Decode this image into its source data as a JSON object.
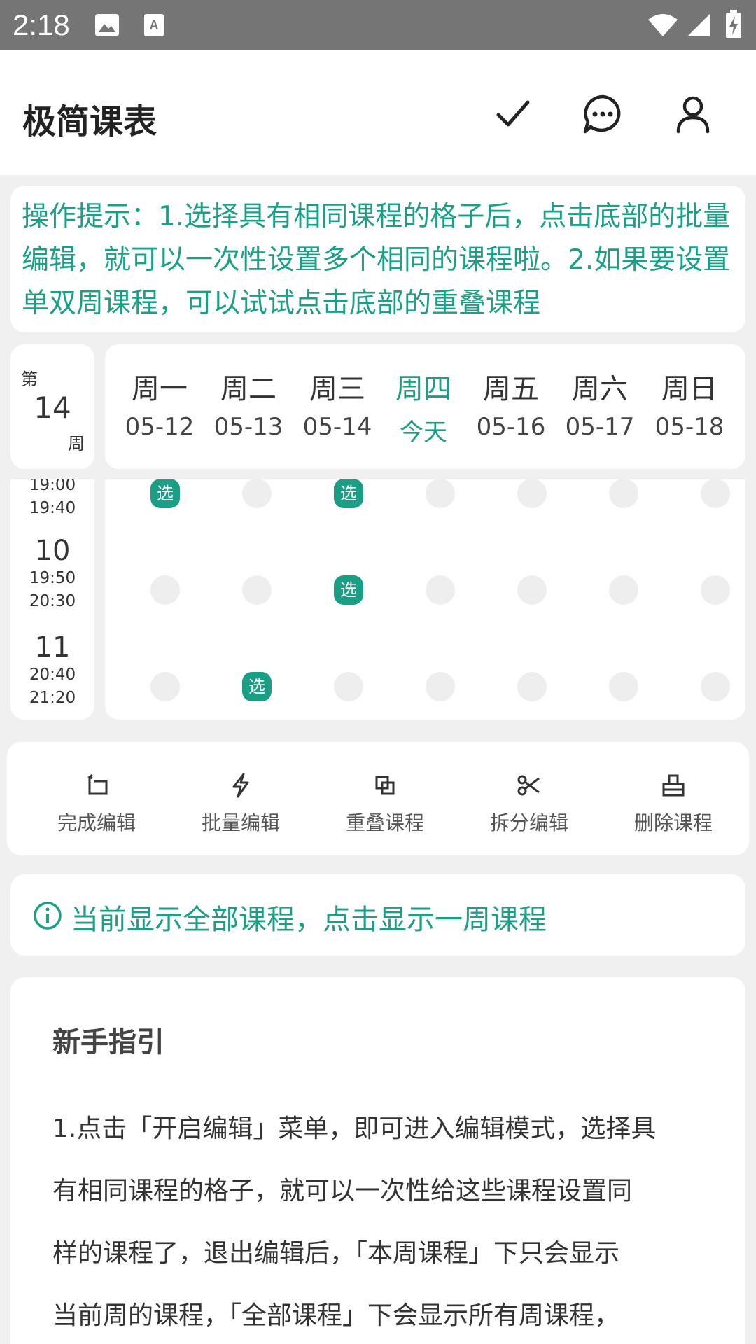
{
  "status_bar": {
    "time": "2:18",
    "icons": [
      "image-icon",
      "keyboard-a-icon",
      "wifi-icon",
      "signal-icon",
      "battery-charging-icon"
    ]
  },
  "app_bar": {
    "title": "极简课表",
    "actions": [
      "check-icon",
      "message-icon",
      "person-icon"
    ]
  },
  "tip": {
    "text": "操作提示：1.选择具有相同课程的格子后，点击底部的批量编辑，就可以一次性设置多个相同的课程啦。2.如果要设置单双周课程，可以试试点击底部的重叠课程"
  },
  "week": {
    "prefix": "第",
    "number": "14",
    "suffix": "周"
  },
  "days": [
    {
      "name": "周一",
      "date": "05-12",
      "today": false
    },
    {
      "name": "周二",
      "date": "05-13",
      "today": false
    },
    {
      "name": "周三",
      "date": "05-14",
      "today": false
    },
    {
      "name": "周四",
      "date": "今天",
      "today": true
    },
    {
      "name": "周五",
      "date": "05-16",
      "today": false
    },
    {
      "name": "周六",
      "date": "05-17",
      "today": false
    },
    {
      "name": "周日",
      "date": "05-18",
      "today": false
    }
  ],
  "slots": [
    {
      "num": "",
      "start": "19:00",
      "end": "19:40",
      "selected": [
        0,
        2
      ]
    },
    {
      "num": "10",
      "start": "19:50",
      "end": "20:30",
      "selected": [
        2
      ]
    },
    {
      "num": "11",
      "start": "20:40",
      "end": "21:20",
      "selected": [
        1
      ]
    }
  ],
  "selected_label": "选",
  "actions": [
    {
      "label": "完成编辑",
      "icon": "undo-arrow-icon"
    },
    {
      "label": "批量编辑",
      "icon": "lightning-icon"
    },
    {
      "label": "重叠课程",
      "icon": "overlap-squares-icon"
    },
    {
      "label": "拆分编辑",
      "icon": "scissors-icon"
    },
    {
      "label": "删除课程",
      "icon": "eraser-icon"
    }
  ],
  "info": {
    "text": "当前显示全部课程，点击显示一周课程",
    "icon": "info-circle-icon"
  },
  "guide": {
    "title": "新手指引",
    "line1": "1.点击「开启编辑」菜单，即可进入编辑模式，选择具",
    "line2": "有相同课程的格子，就可以一次性给这些课程设置同",
    "line3": "样的课程了，退出编辑后，「本周课程」下只会显示",
    "line4": "当前周的课程，「全部课程」下会显示所有周课程，"
  },
  "colors": {
    "accent": "#1aa087",
    "status_bar": "#757575",
    "background": "#f0f0f0"
  }
}
